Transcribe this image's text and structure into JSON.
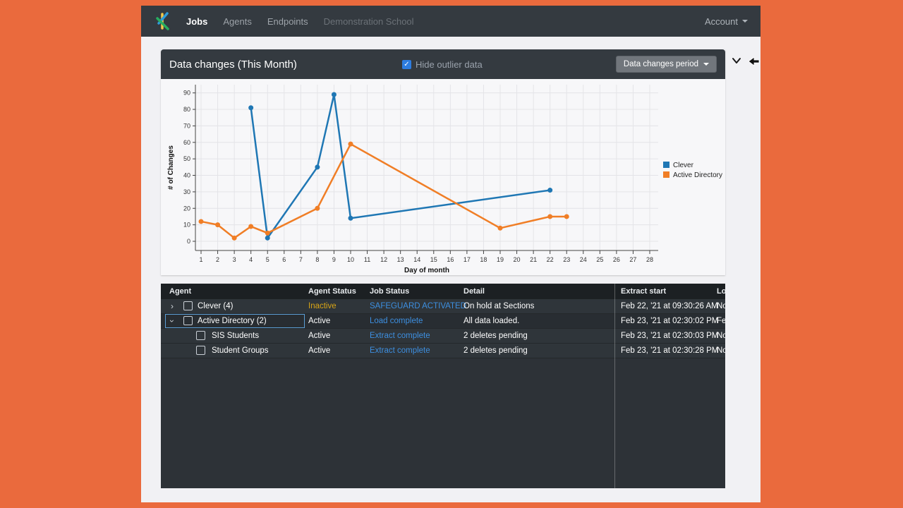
{
  "navbar": {
    "items": [
      {
        "label": "Jobs",
        "state": "active"
      },
      {
        "label": "Agents",
        "state": "normal"
      },
      {
        "label": "Endpoints",
        "state": "normal"
      },
      {
        "label": "Demonstration School",
        "state": "muted"
      }
    ],
    "account_label": "Account"
  },
  "chart_panel": {
    "title": "Data changes (This Month)",
    "hide_outlier_label": "Hide outlier data",
    "hide_outlier_checked": true,
    "checkbox_glyph": "✓",
    "period_button_label": "Data changes period"
  },
  "chart_data": {
    "type": "line",
    "title": "Data changes (This Month)",
    "xlabel": "Day of month",
    "ylabel": "# of Changes",
    "xlim": [
      1,
      28
    ],
    "ylim": [
      0,
      90
    ],
    "x_ticks": [
      1,
      2,
      3,
      4,
      5,
      6,
      7,
      8,
      9,
      10,
      11,
      12,
      13,
      14,
      15,
      16,
      17,
      18,
      19,
      20,
      21,
      22,
      23,
      24,
      25,
      26,
      27,
      28
    ],
    "y_ticks": [
      0,
      10,
      20,
      30,
      40,
      50,
      60,
      70,
      80,
      90
    ],
    "grid": true,
    "legend_position": "right",
    "series": [
      {
        "name": "Clever",
        "color": "#1F77B4",
        "points": [
          [
            4,
            81
          ],
          [
            5,
            2
          ],
          [
            8,
            45
          ],
          [
            9,
            89
          ],
          [
            10,
            14
          ],
          [
            22,
            31
          ]
        ]
      },
      {
        "name": "Active Directory",
        "color": "#F07E26",
        "points": [
          [
            1,
            12
          ],
          [
            2,
            10
          ],
          [
            3,
            2
          ],
          [
            4,
            9
          ],
          [
            5,
            5
          ],
          [
            8,
            20
          ],
          [
            10,
            59
          ],
          [
            19,
            8
          ],
          [
            22,
            15
          ],
          [
            23,
            15
          ]
        ]
      }
    ]
  },
  "table": {
    "columns": [
      "Agent",
      "Agent Status",
      "Job Status",
      "Detail",
      "Extract start",
      "Lo"
    ],
    "link_color": "#3D8FE0",
    "rows": [
      {
        "expand": "collapsed",
        "indent": false,
        "selected": false,
        "agent": "Clever (4)",
        "agent_status": "Inactive",
        "agent_status_color": "#D9A516",
        "job_status": "SAFEGUARD ACTIVATED",
        "detail": "On hold at Sections",
        "extract_start": "Feb 22, '21 at 09:30:26 AM",
        "load_start": "No"
      },
      {
        "expand": "expanded",
        "indent": false,
        "selected": true,
        "agent": "Active Directory (2)",
        "agent_status": "Active",
        "agent_status_color": "#FFFFFF",
        "job_status": "Load complete",
        "detail": "All data loaded.",
        "extract_start": "Feb 23, '21 at 02:30:02 PM",
        "load_start": "Fe"
      },
      {
        "expand": "none",
        "indent": true,
        "selected": false,
        "agent": "SIS Students",
        "agent_status": "Active",
        "agent_status_color": "#FFFFFF",
        "job_status": "Extract complete",
        "detail": "2 deletes pending",
        "extract_start": "Feb 23, '21 at 02:30:03 PM",
        "load_start": "No"
      },
      {
        "expand": "none",
        "indent": true,
        "selected": false,
        "agent": "Student Groups",
        "agent_status": "Active",
        "agent_status_color": "#FFFFFF",
        "job_status": "Extract complete",
        "detail": "2 deletes pending",
        "extract_start": "Feb 23, '21 at 02:30:28 PM",
        "load_start": "No"
      }
    ]
  }
}
